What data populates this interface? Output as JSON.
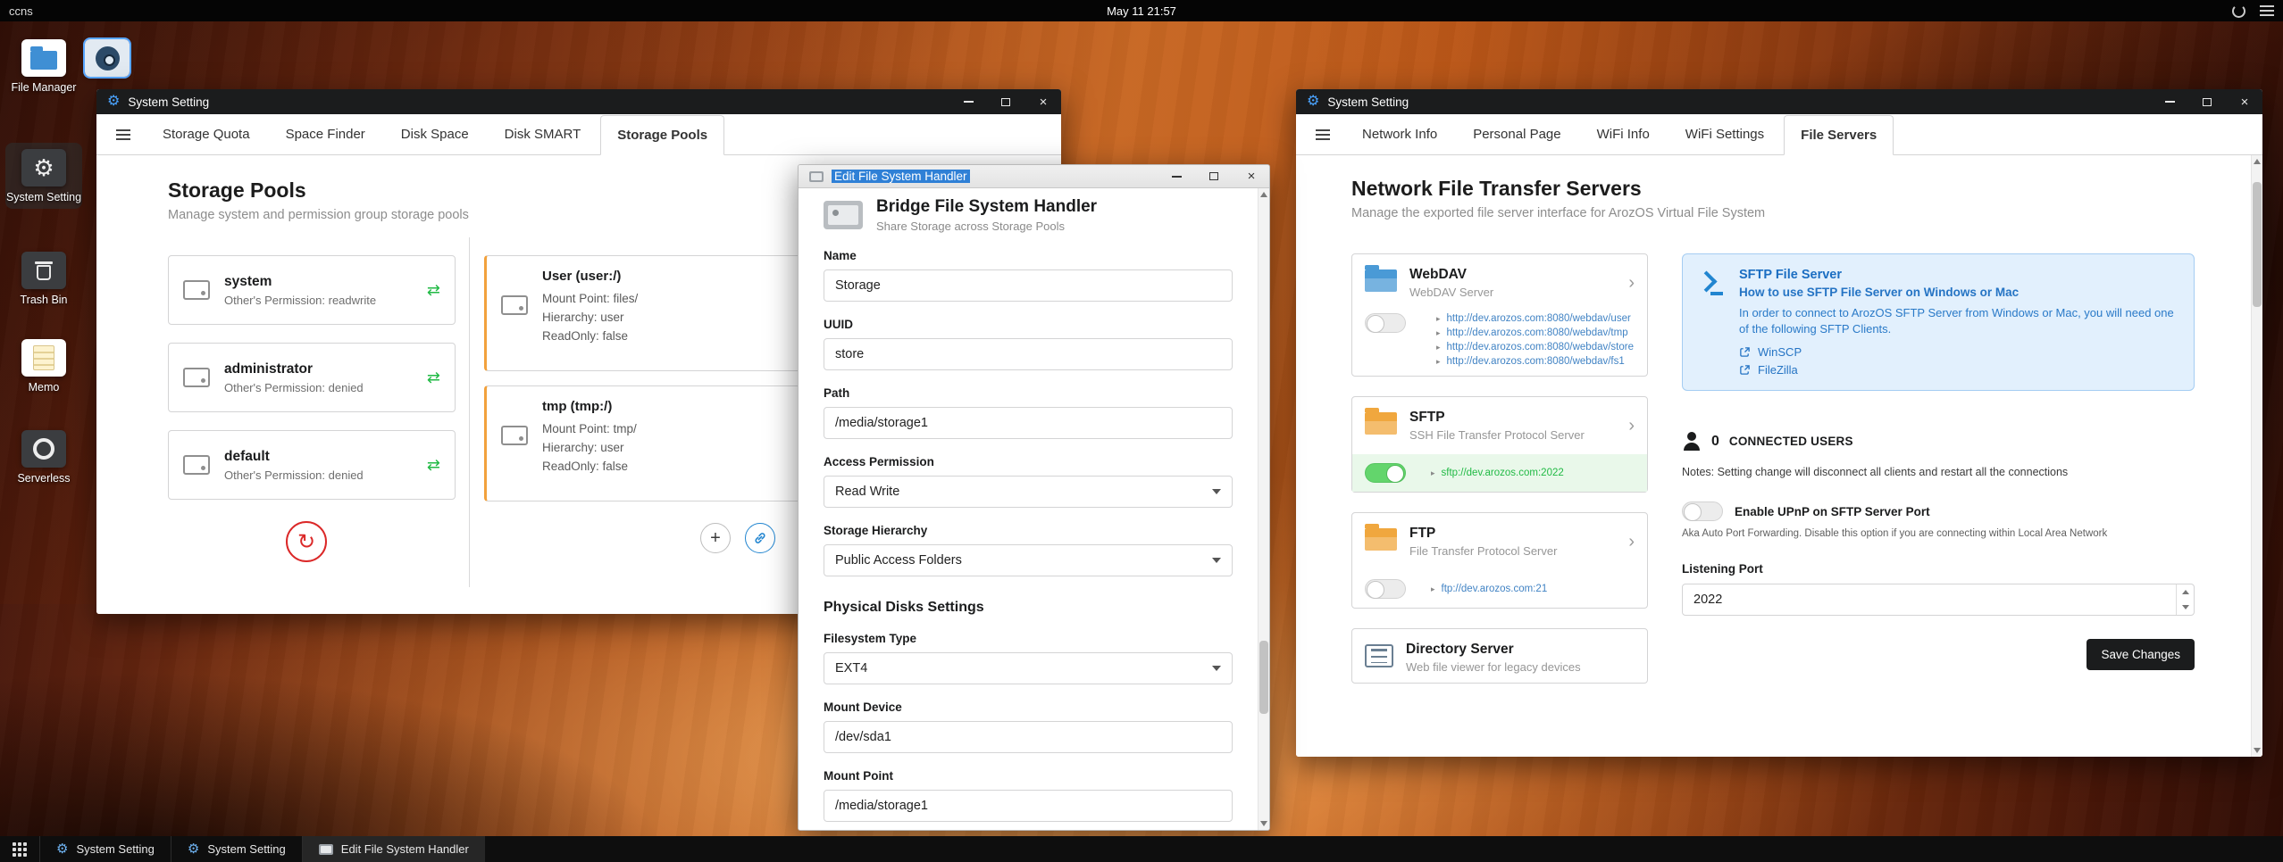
{
  "icons": {
    "gear": "⚙",
    "close": "×",
    "sync": "⇄",
    "refresh": "↻",
    "plus": "+",
    "chevron": "›",
    "caret_right": "▸"
  },
  "colors": {
    "accent_blue": "#2185d0",
    "green": "#21ba45",
    "orange": "#f2a13c",
    "red": "#db2828"
  },
  "topbar": {
    "host": "ccns",
    "clock": "May 11 21:57"
  },
  "desktop": {
    "icons": [
      {
        "label": "File Manager"
      },
      {
        "label": "System Setting"
      },
      {
        "label": "Trash Bin"
      },
      {
        "label": "Memo"
      },
      {
        "label": "Serverless"
      }
    ]
  },
  "window1": {
    "title": "System Setting",
    "tabs": [
      "Storage Quota",
      "Space Finder",
      "Disk Space",
      "Disk SMART",
      "Storage Pools"
    ],
    "heading": "Storage Pools",
    "subheading": "Manage system and permission group storage pools",
    "pools": [
      {
        "name": "system",
        "perm": "Other's Permission: readwrite"
      },
      {
        "name": "administrator",
        "perm": "Other's Permission: denied"
      },
      {
        "name": "default",
        "perm": "Other's Permission: denied"
      }
    ],
    "mounts": [
      {
        "name": "User (user:/)",
        "lines": [
          "Mount Point: files/",
          "Hierarchy: user",
          "ReadOnly: false"
        ]
      },
      {
        "name": "tmp (tmp:/)",
        "lines": [
          "Mount Point: tmp/",
          "Hierarchy: user",
          "ReadOnly: false"
        ]
      }
    ]
  },
  "window2": {
    "title": "Edit File System Handler",
    "heading": "Bridge File System Handler",
    "subheading": "Share Storage across Storage Pools",
    "section": "Physical Disks Settings",
    "fields": {
      "name": {
        "label": "Name",
        "value": "Storage"
      },
      "uuid": {
        "label": "UUID",
        "value": "store"
      },
      "path": {
        "label": "Path",
        "value": "/media/storage1"
      },
      "access": {
        "label": "Access Permission",
        "value": "Read Write"
      },
      "hierarchy": {
        "label": "Storage Hierarchy",
        "value": "Public Access Folders"
      },
      "fstype": {
        "label": "Filesystem Type",
        "value": "EXT4"
      },
      "mountdev": {
        "label": "Mount Device",
        "value": "/dev/sda1"
      },
      "mountpoint": {
        "label": "Mount Point",
        "value": "/media/storage1"
      }
    }
  },
  "window3": {
    "title": "System Setting",
    "tabs": [
      "Network Info",
      "Personal Page",
      "WiFi Info",
      "WiFi Settings",
      "File Servers"
    ],
    "heading": "Network File Transfer Servers",
    "subheading": "Manage the exported file server interface for ArozOS Virtual File System",
    "servers": [
      {
        "name": "WebDAV",
        "desc": "WebDAV Server",
        "links": [
          "http://dev.arozos.com:8080/webdav/user",
          "http://dev.arozos.com:8080/webdav/tmp",
          "http://dev.arozos.com:8080/webdav/store",
          "http://dev.arozos.com:8080/webdav/fs1"
        ]
      },
      {
        "name": "SFTP",
        "desc": "SSH File Transfer Protocol Server",
        "link": "sftp://dev.arozos.com:2022"
      },
      {
        "name": "FTP",
        "desc": "File Transfer Protocol Server",
        "link": "ftp://dev.arozos.com:21"
      },
      {
        "name": "Directory Server",
        "desc": "Web file viewer for legacy devices"
      }
    ],
    "sftp_info": {
      "title": "SFTP File Server",
      "subtitle": "How to use SFTP File Server on Windows or Mac",
      "body": "In order to connect to ArozOS SFTP Server from Windows or Mac, you will need one of the following SFTP Clients.",
      "clients": [
        "WinSCP",
        "FileZilla"
      ]
    },
    "connected": {
      "count": "0",
      "label": "CONNECTED USERS",
      "note": "Notes: Setting change will disconnect all clients and restart all the connections"
    },
    "upnp": {
      "label": "Enable UPnP on SFTP Server Port",
      "desc": "Aka Auto Port Forwarding. Disable this option if you are connecting within Local Area Network"
    },
    "port": {
      "label": "Listening Port",
      "value": "2022"
    },
    "save_label": "Save Changes"
  },
  "taskbar": {
    "items": [
      {
        "label": "System Setting"
      },
      {
        "label": "System Setting"
      },
      {
        "label": "Edit File System Handler"
      }
    ]
  }
}
